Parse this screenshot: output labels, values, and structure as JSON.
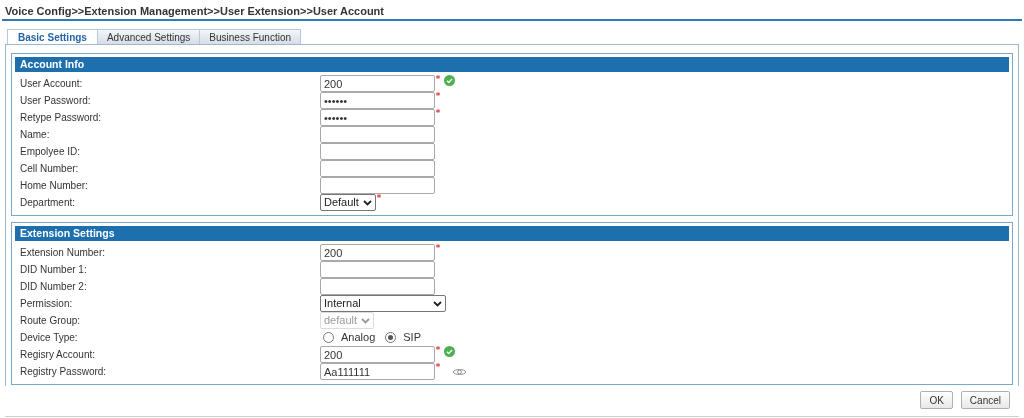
{
  "breadcrumb": "Voice Config>>Extension Management>>User Extension>>User Account",
  "tabs": [
    {
      "label": "Basic Settings",
      "selected": true
    },
    {
      "label": "Advanced Settings",
      "selected": false
    },
    {
      "label": "Business Function",
      "selected": false
    }
  ],
  "sections": [
    {
      "title": "Account Info",
      "rows": [
        {
          "label": "User Account:",
          "kind": "text",
          "value": "200",
          "required": true,
          "valid": true
        },
        {
          "label": "User Password:",
          "kind": "text",
          "value": "••••••",
          "required": true
        },
        {
          "label": "Retype Password:",
          "kind": "text",
          "value": "••••••",
          "required": true
        },
        {
          "label": "Name:",
          "kind": "text"
        },
        {
          "label": "Empolyee ID:",
          "kind": "text"
        },
        {
          "label": "Cell Number:",
          "kind": "text"
        },
        {
          "label": "Home Number:",
          "kind": "text"
        },
        {
          "label": "Department:",
          "kind": "select",
          "value": "Default",
          "required": true
        }
      ]
    },
    {
      "title": "Extension Settings",
      "rows": [
        {
          "label": "Extension Number:",
          "kind": "text",
          "value": "200",
          "required": true
        },
        {
          "label": "DID Number 1:",
          "kind": "text"
        },
        {
          "label": "DID Number 2:",
          "kind": "text"
        },
        {
          "label": "Permission:",
          "kind": "select",
          "value": "Internal",
          "wide": true
        },
        {
          "label": "Route Group:",
          "kind": "select",
          "value": "default",
          "disabled": true
        },
        {
          "label": "Device Type:",
          "kind": "radio",
          "options": [
            {
              "label": "Analog",
              "selected": false
            },
            {
              "label": "SIP",
              "selected": true
            }
          ]
        },
        {
          "label": "Regisry Account:",
          "kind": "text",
          "value": "200",
          "required": true,
          "valid": true
        },
        {
          "label": "Registry Password:",
          "kind": "text",
          "value": "Aa111111",
          "required": true,
          "reveal": true
        }
      ]
    }
  ],
  "buttons": [
    "OK",
    "Cancel"
  ]
}
